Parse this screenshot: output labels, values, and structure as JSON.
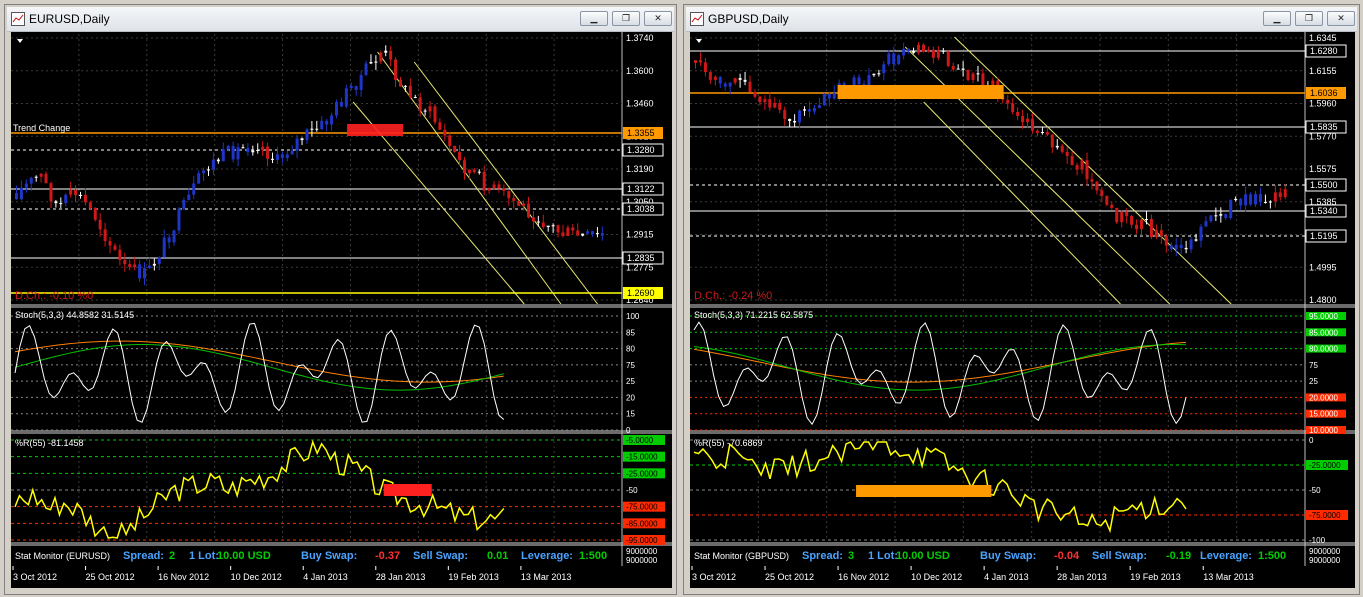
{
  "windows": [
    {
      "id": "eurusd",
      "title": "EURUSD,Daily",
      "trend_label": "Trend Change",
      "dch_label": "D.Ch.: -0.10 %0",
      "price_ticks": [
        "1.3740",
        "1.3600",
        "1.3460",
        "1.3325",
        "1.3190",
        "1.3050",
        "1.2915",
        "1.2775",
        "1.2640"
      ],
      "price_tags": [
        {
          "text": "1.3355",
          "style": "orange"
        },
        {
          "text": "1.3280",
          "style": "white"
        },
        {
          "text": "1.3122",
          "style": "white"
        },
        {
          "text": "1.3038",
          "style": "white"
        },
        {
          "text": "1.2835",
          "style": "white"
        },
        {
          "text": "1.2690",
          "style": "yellow"
        }
      ],
      "stoch_label": "Stoch(5,3,3) 44.8582 31.5145",
      "stoch_ticks": [
        "100",
        "85",
        "80",
        "75",
        "25",
        "20",
        "15",
        "0"
      ],
      "wpr_label": "%R(55) -81.1458",
      "wpr_tags": [
        {
          "text": "-5.0000",
          "style": "green"
        },
        {
          "text": "-15.0000",
          "style": "green"
        },
        {
          "text": "-25.0000",
          "style": "green"
        },
        {
          "text": "-50",
          "style": "plain"
        },
        {
          "text": "-75.0000",
          "style": "red"
        },
        {
          "text": "-85.0000",
          "style": "red"
        },
        {
          "text": "-95.0000",
          "style": "red"
        }
      ],
      "status": {
        "name": "Stat Monitor (EURUSD)",
        "spread_label": "Spread:",
        "spread": "2",
        "lot_label": "1 Lot:",
        "lot": "10.00 USD",
        "buy_label": "Buy Swap:",
        "buy": "-0.37",
        "sell_label": "Sell Swap:",
        "sell": "0.01",
        "lev_label": "Leverage:",
        "lev": "1:500"
      },
      "status_ticks": [
        "9000000",
        "9000000"
      ],
      "dates": [
        "3 Oct 2012",
        "25 Oct 2012",
        "16 Nov 2012",
        "10 Dec 2012",
        "4 Jan 2013",
        "28 Jan 2013",
        "19 Feb 2013",
        "13 Mar 2013"
      ]
    },
    {
      "id": "gbpusd",
      "title": "GBPUSD,Daily",
      "trend_label": "",
      "dch_label": "D.Ch.: -0.24 %0",
      "price_ticks": [
        "1.6345",
        "1.6155",
        "1.5960",
        "1.5770",
        "1.5575",
        "1.5385",
        "1.5195",
        "1.4995",
        "1.4800"
      ],
      "price_tags": [
        {
          "text": "1.6280",
          "style": "white"
        },
        {
          "text": "1.6036",
          "style": "orange"
        },
        {
          "text": "1.5835",
          "style": "white"
        },
        {
          "text": "1.5500",
          "style": "white"
        },
        {
          "text": "1.5340",
          "style": "white"
        },
        {
          "text": "1.5195",
          "style": "white"
        }
      ],
      "stoch_label": "Stoch(5,3,3) 71.2215 62.5875",
      "stoch_ticks": [
        "95.0000",
        "85.0000",
        "80.0000",
        "75",
        "25",
        "20.0000",
        "15.0000",
        "10.0000"
      ],
      "wpr_label": "%R(55) -70.6869",
      "wpr_tags": [
        {
          "text": "0",
          "style": "plain"
        },
        {
          "text": "-25.0000",
          "style": "green"
        },
        {
          "text": "-50",
          "style": "plain"
        },
        {
          "text": "-75.0000",
          "style": "red"
        },
        {
          "text": "-100",
          "style": "plain"
        }
      ],
      "status": {
        "name": "Stat Monitor (GBPUSD)",
        "spread_label": "Spread:",
        "spread": "3",
        "lot_label": "1 Lot:",
        "lot": "10.00 USD",
        "buy_label": "Buy Swap:",
        "buy": "-0.04",
        "sell_label": "Sell Swap:",
        "sell": "-0.19",
        "lev_label": "Leverage:",
        "lev": "1:500"
      },
      "status_ticks": [
        "9000000",
        "9000000"
      ],
      "dates": [
        "3 Oct 2012",
        "25 Oct 2012",
        "16 Nov 2012",
        "10 Dec 2012",
        "4 Jan 2013",
        "28 Jan 2013",
        "19 Feb 2013",
        "13 Mar 2013"
      ]
    }
  ],
  "colors": {
    "chart_bg": "#000000",
    "grid": "#3a3a3a",
    "bull": "#1f35c8",
    "bear": "#d01818",
    "doji": "#ffffff",
    "orange": "#ff9900",
    "yellow": "#ffff00",
    "green": "#00cc00",
    "red_level": "#ff2a00",
    "stoch_main": "#ffffff",
    "stoch_signal": "#00c000",
    "stoch_slow": "#ff8000",
    "wpr": "#ffff00"
  },
  "icons": [
    "chart-window-icon",
    "minimize-icon",
    "restore-icon",
    "close-icon",
    "dropdown-arrow-icon"
  ]
}
